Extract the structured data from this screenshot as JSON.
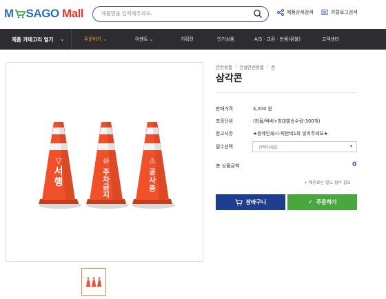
{
  "header": {
    "logo_text_1": "M",
    "logo_text_2": "SAGO",
    "logo_text_3": "Mall",
    "search_placeholder": "제품명을 입력해주세요.",
    "link_detail_search": "제품상세검색",
    "link_catalog_search": "카탈로그검색"
  },
  "nav": {
    "category_label": "제품 카테고리 열기",
    "items": [
      {
        "label": "주문하기",
        "chevron": "⌄",
        "active": true
      },
      {
        "label": "이벤트",
        "chevron": "⌄",
        "active": false
      },
      {
        "label": "기획전",
        "chevron": "",
        "active": false
      },
      {
        "label": "인기상품",
        "chevron": "",
        "active": false
      },
      {
        "label": "A/S · 교환 · 반품(환불)",
        "chevron": "",
        "active": false
      },
      {
        "label": "고객센터",
        "chevron": "",
        "active": false
      }
    ]
  },
  "product": {
    "breadcrumb": [
      "안전용품",
      "건설안전용품",
      "콘"
    ],
    "title": "삼각콘",
    "price_label": "판매가격",
    "price_value": "4,200 원",
    "package_label": "포장단위",
    "package_value": "(화물/택배+최대발송수량-300개)",
    "note_label": "참고사항",
    "note_value": "★용제인쇄시-제판비1회 넣어주세요★",
    "required_label": "필수선택",
    "select_placeholder": "선택하세요",
    "total_label": "총 상품금액",
    "total_value": "0",
    "shipping_note": "+ 배송료는 별도 협의 필요",
    "cart_button": "장바구니",
    "order_button": "주문하기"
  },
  "cones": [
    {
      "text": "서행",
      "sign": "▽"
    },
    {
      "text": "주차금지",
      "sign": "⊘"
    },
    {
      "text": "공사중",
      "sign": "⚠"
    }
  ],
  "colors": {
    "brand_blue": "#2c6fb4",
    "brand_red": "#e23b2e",
    "nav_bg": "#2d2d31",
    "nav_active": "#f4a23b",
    "cart_button": "#1f3d8f",
    "order_button": "#4aa63e",
    "cone_orange": "#f0502a"
  }
}
